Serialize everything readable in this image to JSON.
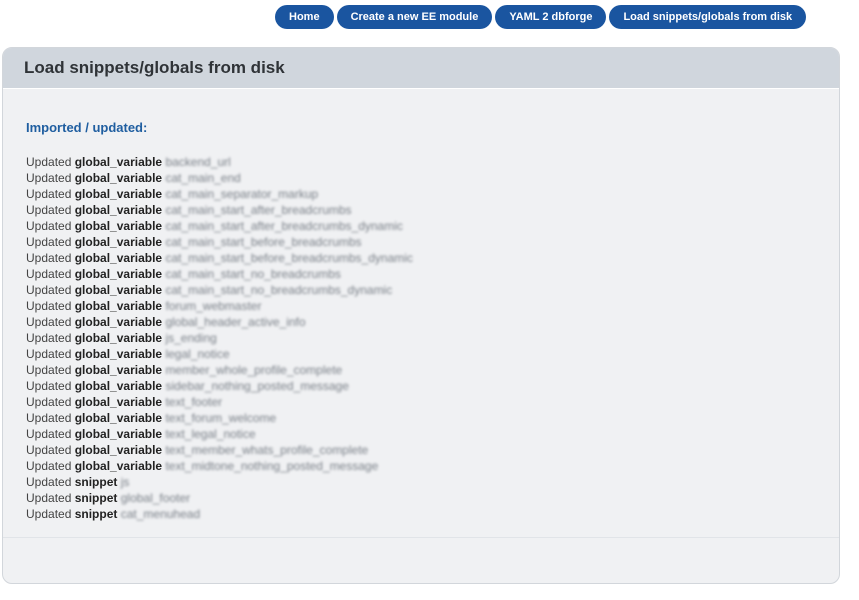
{
  "nav": {
    "home": "Home",
    "create": "Create a new EE module",
    "yaml": "YAML 2 dbforge",
    "load": "Load snippets/globals from disk"
  },
  "panel": {
    "title": "Load snippets/globals from disk",
    "section_title": "Imported / updated:"
  },
  "updates": [
    {
      "verb": "Updated",
      "kind": "global_variable",
      "name": "backend_url"
    },
    {
      "verb": "Updated",
      "kind": "global_variable",
      "name": "cat_main_end"
    },
    {
      "verb": "Updated",
      "kind": "global_variable",
      "name": "cat_main_separator_markup"
    },
    {
      "verb": "Updated",
      "kind": "global_variable",
      "name": "cat_main_start_after_breadcrumbs"
    },
    {
      "verb": "Updated",
      "kind": "global_variable",
      "name": "cat_main_start_after_breadcrumbs_dynamic"
    },
    {
      "verb": "Updated",
      "kind": "global_variable",
      "name": "cat_main_start_before_breadcrumbs"
    },
    {
      "verb": "Updated",
      "kind": "global_variable",
      "name": "cat_main_start_before_breadcrumbs_dynamic"
    },
    {
      "verb": "Updated",
      "kind": "global_variable",
      "name": "cat_main_start_no_breadcrumbs"
    },
    {
      "verb": "Updated",
      "kind": "global_variable",
      "name": "cat_main_start_no_breadcrumbs_dynamic"
    },
    {
      "verb": "Updated",
      "kind": "global_variable",
      "name": "forum_webmaster"
    },
    {
      "verb": "Updated",
      "kind": "global_variable",
      "name": "global_header_active_info"
    },
    {
      "verb": "Updated",
      "kind": "global_variable",
      "name": "js_ending"
    },
    {
      "verb": "Updated",
      "kind": "global_variable",
      "name": "legal_notice"
    },
    {
      "verb": "Updated",
      "kind": "global_variable",
      "name": "member_whole_profile_complete"
    },
    {
      "verb": "Updated",
      "kind": "global_variable",
      "name": "sidebar_nothing_posted_message"
    },
    {
      "verb": "Updated",
      "kind": "global_variable",
      "name": "text_footer"
    },
    {
      "verb": "Updated",
      "kind": "global_variable",
      "name": "text_forum_welcome"
    },
    {
      "verb": "Updated",
      "kind": "global_variable",
      "name": "text_legal_notice"
    },
    {
      "verb": "Updated",
      "kind": "global_variable",
      "name": "text_member_whats_profile_complete"
    },
    {
      "verb": "Updated",
      "kind": "global_variable",
      "name": "text_midtone_nothing_posted_message"
    },
    {
      "verb": "Updated",
      "kind": "snippet",
      "name": "js"
    },
    {
      "verb": "Updated",
      "kind": "snippet",
      "name": "global_footer"
    },
    {
      "verb": "Updated",
      "kind": "snippet",
      "name": "cat_menuhead"
    }
  ]
}
